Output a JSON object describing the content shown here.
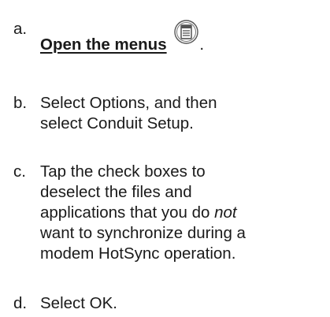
{
  "steps": [
    {
      "marker": "a.",
      "link_text": "Open the menus",
      "icon": "menu-icon",
      "trailing": "."
    },
    {
      "marker": "b.",
      "line1": "Select Options, and then",
      "line2": "select Conduit Setup."
    },
    {
      "marker": "c.",
      "line1": "Tap the check boxes to",
      "line2": "deselect the files and",
      "line3_pre": "applications that you do ",
      "line3_em": "not",
      "line4": "want to synchronize during a",
      "line5": "modem HotSync operation."
    },
    {
      "marker": "d.",
      "text": "Select OK."
    }
  ]
}
